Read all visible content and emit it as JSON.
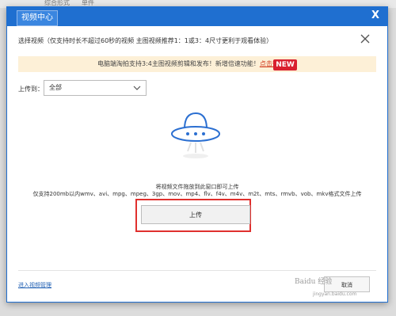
{
  "background": {
    "left_text": "综合形式",
    "right_text": "单件"
  },
  "window": {
    "tab_label": "视频中心",
    "close_glyph": "X",
    "select_video_text": "选择视频（仅支持时长不超过60秒的视频 主图视频推荐1：1或3：4尺寸更利于观看体验）",
    "close_icon": "close-icon"
  },
  "notice": {
    "message": "电脑端淘拍支持3:4主图视频剪辑和发布！新增倍速功能！",
    "link": "点击查看",
    "badge": "NEW",
    "bg_color": "#fdf0d7",
    "badge_color": "#d9202f"
  },
  "upload_to": {
    "label": "上传到：",
    "selected": "全部"
  },
  "dropzone": {
    "icon": "ufo-upload-icon",
    "drag_text": "将视频文件拖放到此窗口即可上传",
    "formats_text": "仅支持200mb以内wmv、avi、mpg、mpeg、3gp、mov、mp4、flv、f4v、m4v、m2t、mts、rmvb、vob、mkv格式文件上传",
    "upload_button": "上传",
    "highlight_color": "#e0302e"
  },
  "footer": {
    "manage_link": "进入视频管理",
    "cancel_button": "取消"
  },
  "watermark": {
    "brand": "Baidu 经验",
    "url": "jingyan.baidu.com"
  },
  "accent_color": "#1f6fd0"
}
